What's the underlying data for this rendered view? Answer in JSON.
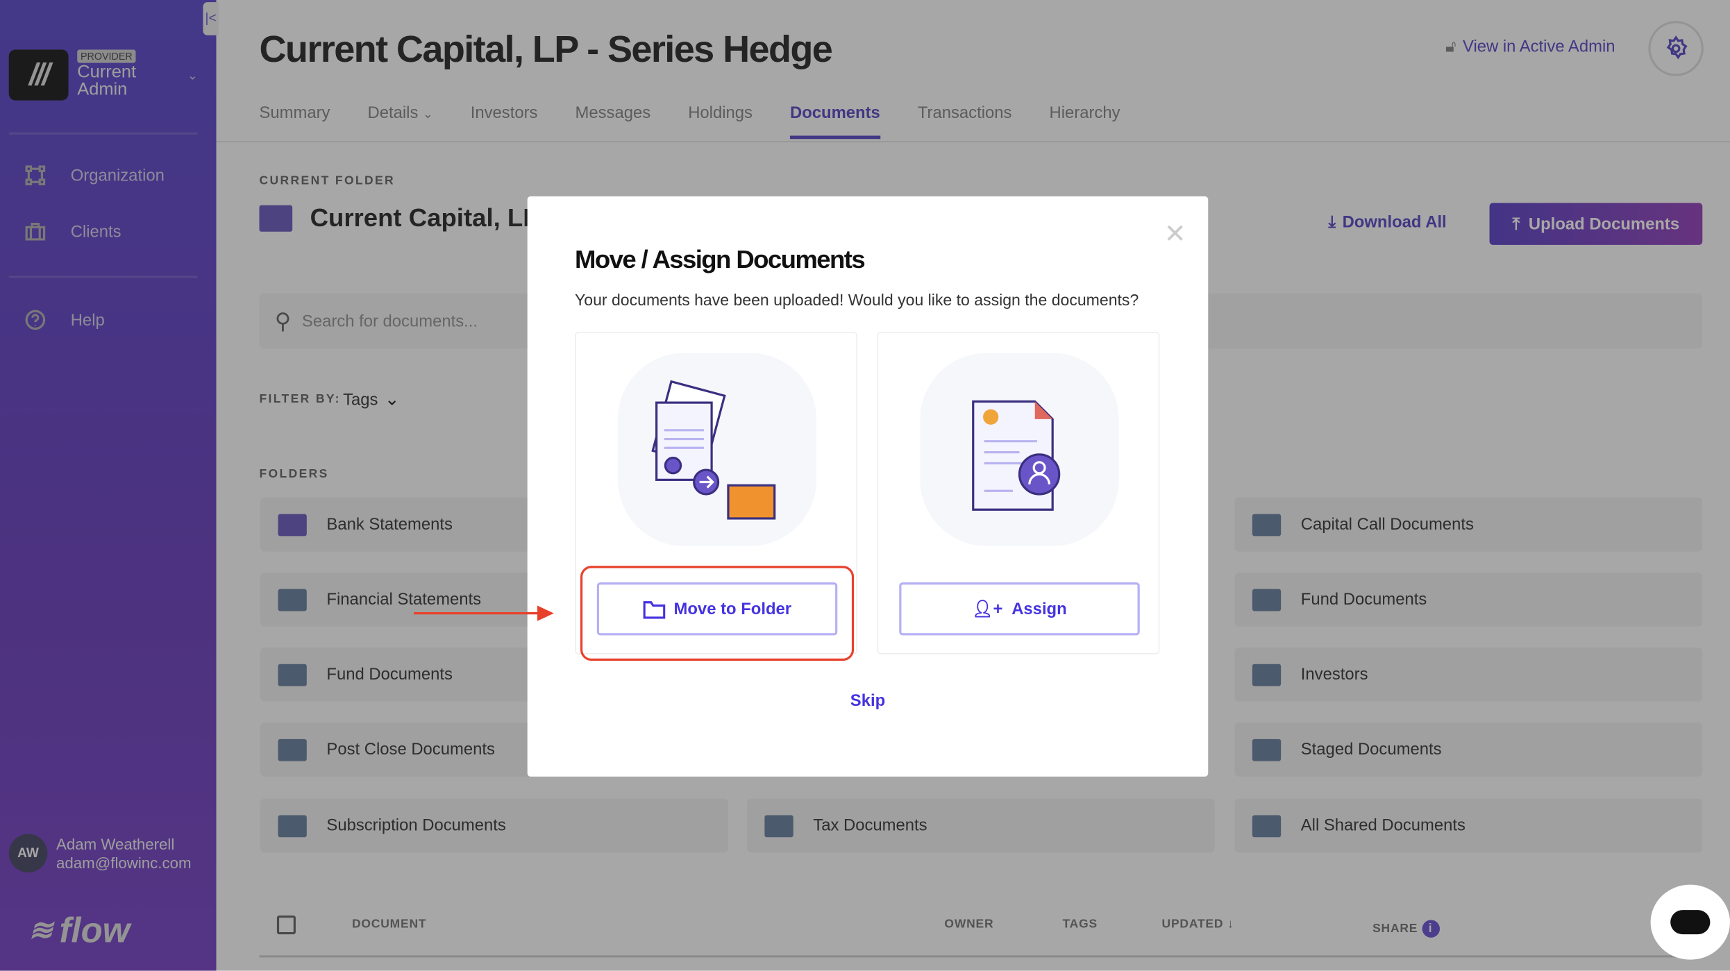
{
  "sidebar": {
    "badge": "PROVIDER",
    "org_name": "Current Admin",
    "items": [
      {
        "label": "Organization",
        "icon": "organization-icon"
      },
      {
        "label": "Clients",
        "icon": "briefcase-icon"
      },
      {
        "label": "Help",
        "icon": "help-icon"
      }
    ],
    "user": {
      "initials": "AW",
      "name": "Adam Weatherell",
      "email": "adam@flowinc.com"
    },
    "brand": "flow"
  },
  "header": {
    "title": "Current Capital, LP - Series Hedge",
    "admin_link": "View in Active Admin",
    "tabs": [
      {
        "label": "Summary"
      },
      {
        "label": "Details"
      },
      {
        "label": "Investors"
      },
      {
        "label": "Messages"
      },
      {
        "label": "Holdings"
      },
      {
        "label": "Documents",
        "active": true
      },
      {
        "label": "Transactions"
      },
      {
        "label": "Hierarchy"
      }
    ]
  },
  "main": {
    "current_folder_label": "CURRENT FOLDER",
    "current_folder": "Current Capital, LP",
    "download_all": "Download All",
    "upload": "Upload Documents",
    "search_placeholder": "Search for documents...",
    "filter_label": "FILTER BY:",
    "filter_value": "Tags",
    "folders_label": "FOLDERS",
    "folders_left": [
      "Bank Statements",
      "Financial Statements",
      "Fund Documents",
      "Post Close Documents",
      "Subscription Documents"
    ],
    "folders_middle": [
      "Tax Documents"
    ],
    "folders_right": [
      "Capital Call Documents",
      "Fund Documents",
      "Investors",
      "Staged Documents",
      "All Shared Documents"
    ],
    "table_headers": {
      "document": "DOCUMENT",
      "owner": "OWNER",
      "tags": "TAGS",
      "updated": "UPDATED",
      "share": "SHARE"
    }
  },
  "modal": {
    "title": "Move / Assign Documents",
    "subtitle": "Your documents have been uploaded! Would you like to assign the documents?",
    "move_button": "Move to Folder",
    "assign_button": "Assign",
    "skip": "Skip"
  },
  "colors": {
    "accent": "#4533c0",
    "highlight": "#e8412b",
    "sidebar": "#4b35c8"
  }
}
